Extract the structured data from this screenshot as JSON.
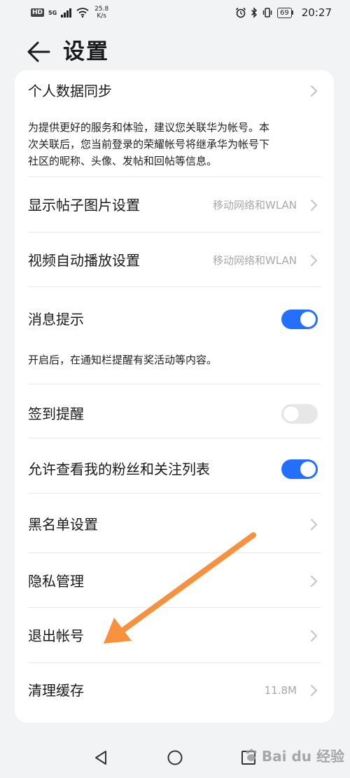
{
  "status_bar": {
    "hd": "HD",
    "signal_label": "5G",
    "speed_value": "25.8",
    "speed_unit": "K/s",
    "battery": "69",
    "time": "20:27"
  },
  "header": {
    "title": "设置"
  },
  "settings": {
    "sync": {
      "title": "个人数据同步",
      "description": "为提供更好的服务和体验，建议您关联华为帐号。本次关联后，您当前登录的荣耀帐号将继承华为帐号下社区的昵称、头像、发帖和回帖等信息。",
      "desc_lines": [
        "为提供更好的服务和体验，建议您关联华为帐号。本",
        "次关联后，您当前登录的荣耀帐号将继承华为帐号下",
        "社区的昵称、头像、发帖和回帖等信息。"
      ]
    },
    "post_images": {
      "title": "显示帖子图片设置",
      "value": "移动网络和WLAN"
    },
    "video_autoplay": {
      "title": "视频自动播放设置",
      "value": "移动网络和WLAN"
    },
    "notifications": {
      "title": "消息提示",
      "description": "开启后，在通知栏提醒有奖活动等内容。",
      "enabled": true
    },
    "checkin_reminder": {
      "title": "签到提醒",
      "enabled": false
    },
    "fans_visibility": {
      "title": "允许查看我的粉丝和关注列表",
      "enabled": true
    },
    "blacklist": {
      "title": "黑名单设置"
    },
    "privacy": {
      "title": "隐私管理"
    },
    "logout": {
      "title": "退出帐号"
    },
    "clear_cache": {
      "title": "清理缓存",
      "value": "11.8M"
    }
  },
  "watermark": {
    "text": "Bai du 经验"
  },
  "colors": {
    "accent": "#256fff",
    "annotation_arrow": "#f7913d",
    "background": "#f1f3f5",
    "card": "#ffffff"
  }
}
